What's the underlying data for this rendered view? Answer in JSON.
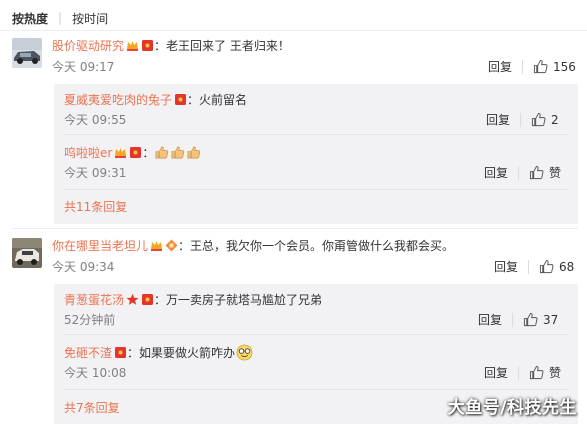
{
  "sort_tabs": {
    "hot": "按热度",
    "time": "按时间"
  },
  "colors": {
    "username": "#eb7350",
    "sub_bg": "#f2f2f5",
    "link": "#eb7350"
  },
  "comments": [
    {
      "username": "股价驱动研究",
      "text": "：老王回来了 王者归来！",
      "time": "今天 09:17",
      "reply_label": "回复",
      "likes": "156",
      "avatar": "car-photo-avatar",
      "replies": [
        {
          "username": "夏威夷爱吃肉的兔子",
          "text": "：火前留名",
          "time": "今天 09:55",
          "reply_label": "回复",
          "likes": "2"
        },
        {
          "username": "呜啦啦er",
          "text": "：",
          "emoji": "thumbs-up-x3",
          "time": "今天 09:31",
          "reply_label": "回复",
          "likes": "赞"
        }
      ],
      "more": "共11条回复"
    },
    {
      "username": "你在哪里当老坦儿",
      "text": "：王总，我欠你一个会员。你甭管做什么我都会买。",
      "time": "今天 09:34",
      "reply_label": "回复",
      "likes": "68",
      "avatar": "car-photo-avatar",
      "replies": [
        {
          "username": "青葱蛋花汤",
          "text": "：万一卖房子就塔马尴尬了兄弟",
          "time": "52分钟前",
          "reply_label": "回复",
          "likes": "37"
        },
        {
          "username": "免砸不渣",
          "text": "：如果要做火箭咋办",
          "emoji": "glasses-smile",
          "time": "今天 10:08",
          "reply_label": "回复",
          "likes": "赞"
        }
      ],
      "more": "共7条回复"
    }
  ],
  "watermark": "大鱼号/科技先生"
}
